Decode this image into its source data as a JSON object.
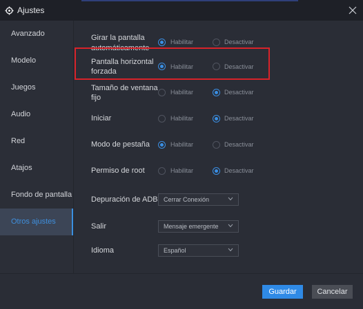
{
  "window": {
    "title": "Ajustes"
  },
  "sidebar": {
    "items": [
      {
        "label": "Avanzado",
        "active": false
      },
      {
        "label": "Modelo",
        "active": false
      },
      {
        "label": "Juegos",
        "active": false
      },
      {
        "label": "Audio",
        "active": false
      },
      {
        "label": "Red",
        "active": false
      },
      {
        "label": "Atajos",
        "active": false
      },
      {
        "label": "Fondo de pantalla",
        "active": false
      },
      {
        "label": "Otros ajustes",
        "active": true
      }
    ]
  },
  "settings": {
    "option_on": "Habilitar",
    "option_off": "Desactivar",
    "rows": [
      {
        "label_line1": "Girar la pantalla",
        "label_line2": "automáticamente",
        "selected": "Habilitar"
      },
      {
        "label_line1": "Pantalla horizontal",
        "label_line2": "forzada",
        "selected": "Habilitar"
      },
      {
        "label_line1": "Tamaño de ventana",
        "label_line2": "fijo",
        "selected": "Desactivar"
      },
      {
        "label_line1": "Iniciar",
        "selected": "Desactivar"
      },
      {
        "label_line1": "Modo de pestaña",
        "selected": "Habilitar"
      },
      {
        "label_line1": "Permiso de root",
        "selected": "Desactivar"
      }
    ],
    "dropdowns": [
      {
        "label": "Depuración de ADB",
        "value": "Cerrar Conexión"
      },
      {
        "label": "Salir",
        "value": "Mensaje emergente"
      },
      {
        "label": "Idioma",
        "value": "Español"
      }
    ]
  },
  "footer": {
    "save_label": "Guardar",
    "cancel_label": "Cancelar"
  },
  "colors": {
    "accent": "#2f8ae6",
    "highlight": "#d9232a",
    "background": "#2a2d36"
  }
}
